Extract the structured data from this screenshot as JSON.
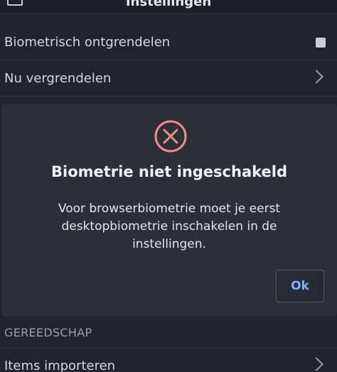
{
  "header": {
    "title": "Instellingen",
    "menu_icon": "menu-icon"
  },
  "settings": {
    "biometric_unlock_label": "Biometrisch ontgrendelen",
    "lock_now_label": "Nu vergrendelen",
    "tools_section": "GEREEDSCHAP",
    "import_items_label": "Items importeren"
  },
  "dialog": {
    "icon": "error-circle-x-icon",
    "title": "Biometrie niet ingeschakeld",
    "message": "Voor browserbiometrie moet je eerst desktopbiometrie inschakelen in de instellingen.",
    "ok_label": "Ok"
  },
  "colors": {
    "background": "#1f242d",
    "dialog_bg": "#2a2f38",
    "error": "#f08d85",
    "accent": "#7fb0ff"
  }
}
